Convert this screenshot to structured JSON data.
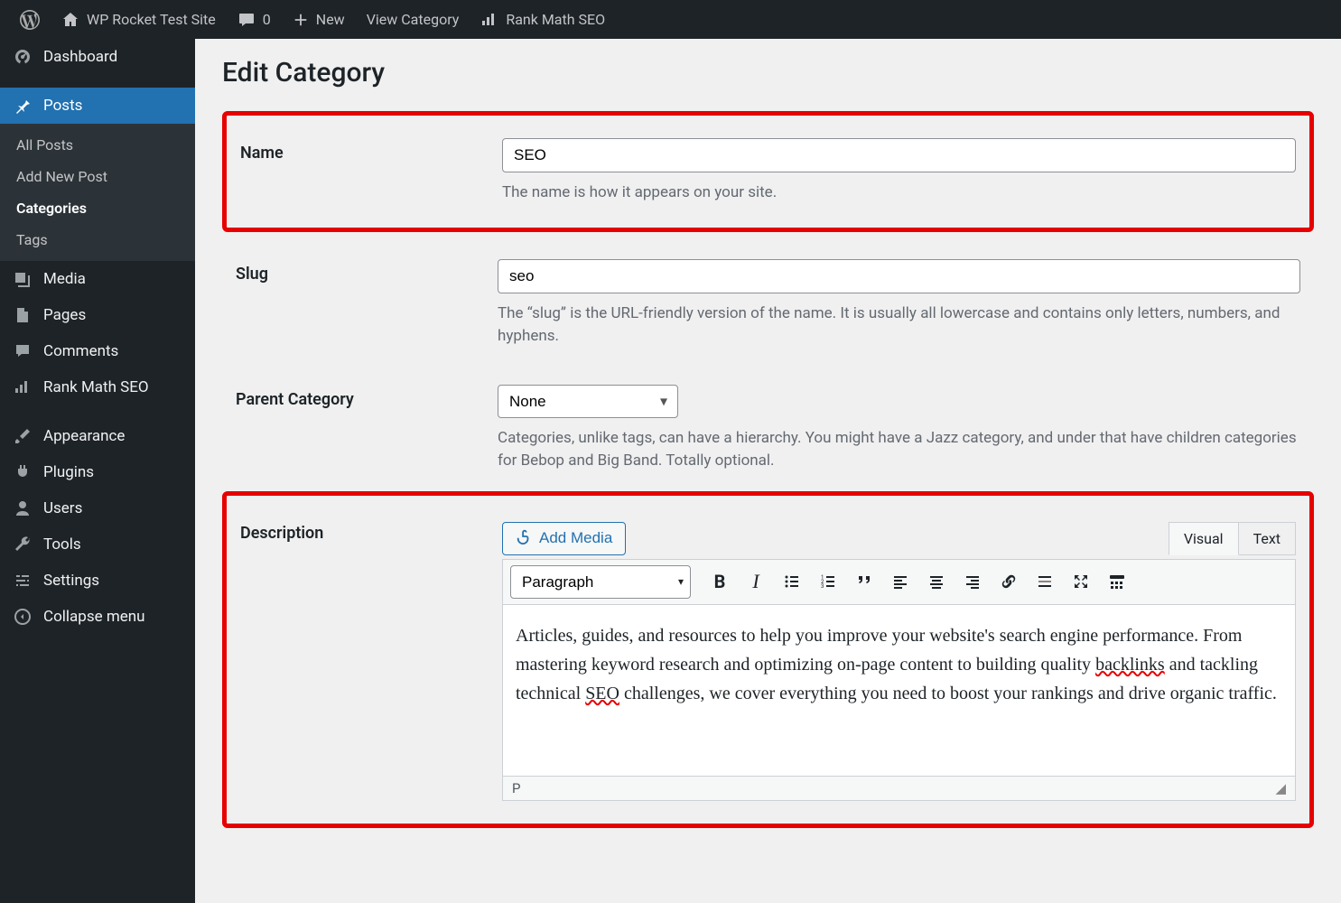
{
  "adminbar": {
    "site_title": "WP Rocket Test Site",
    "comments_count": "0",
    "new_label": "New",
    "view_category": "View Category",
    "rank_math": "Rank Math SEO"
  },
  "sidebar": {
    "dashboard": "Dashboard",
    "posts": "Posts",
    "posts_sub": {
      "all": "All Posts",
      "add_new": "Add New Post",
      "categories": "Categories",
      "tags": "Tags"
    },
    "media": "Media",
    "pages": "Pages",
    "comments": "Comments",
    "rank_math": "Rank Math SEO",
    "appearance": "Appearance",
    "plugins": "Plugins",
    "users": "Users",
    "tools": "Tools",
    "settings": "Settings",
    "collapse": "Collapse menu"
  },
  "page": {
    "title": "Edit Category"
  },
  "fields": {
    "name": {
      "label": "Name",
      "value": "SEO",
      "help": "The name is how it appears on your site."
    },
    "slug": {
      "label": "Slug",
      "value": "seo",
      "help": "The “slug” is the URL-friendly version of the name. It is usually all lowercase and contains only letters, numbers, and hyphens."
    },
    "parent": {
      "label": "Parent Category",
      "selected": "None",
      "help": "Categories, unlike tags, can have a hierarchy. You might have a Jazz category, and under that have children categories for Bebop and Big Band. Totally optional."
    },
    "description": {
      "label": "Description",
      "add_media": "Add Media",
      "tabs": {
        "visual": "Visual",
        "text": "Text"
      },
      "format_label": "Paragraph",
      "content_parts": {
        "p1": "Articles, guides, and resources to help you improve your website's search engine performance. From mastering keyword research and optimizing on-page content to building quality ",
        "sp1": "backlinks",
        "p2": " and tackling technical ",
        "sp2": "SEO",
        "p3": " challenges, we cover everything you need to boost your rankings and drive organic traffic."
      },
      "status_path": "P"
    }
  }
}
